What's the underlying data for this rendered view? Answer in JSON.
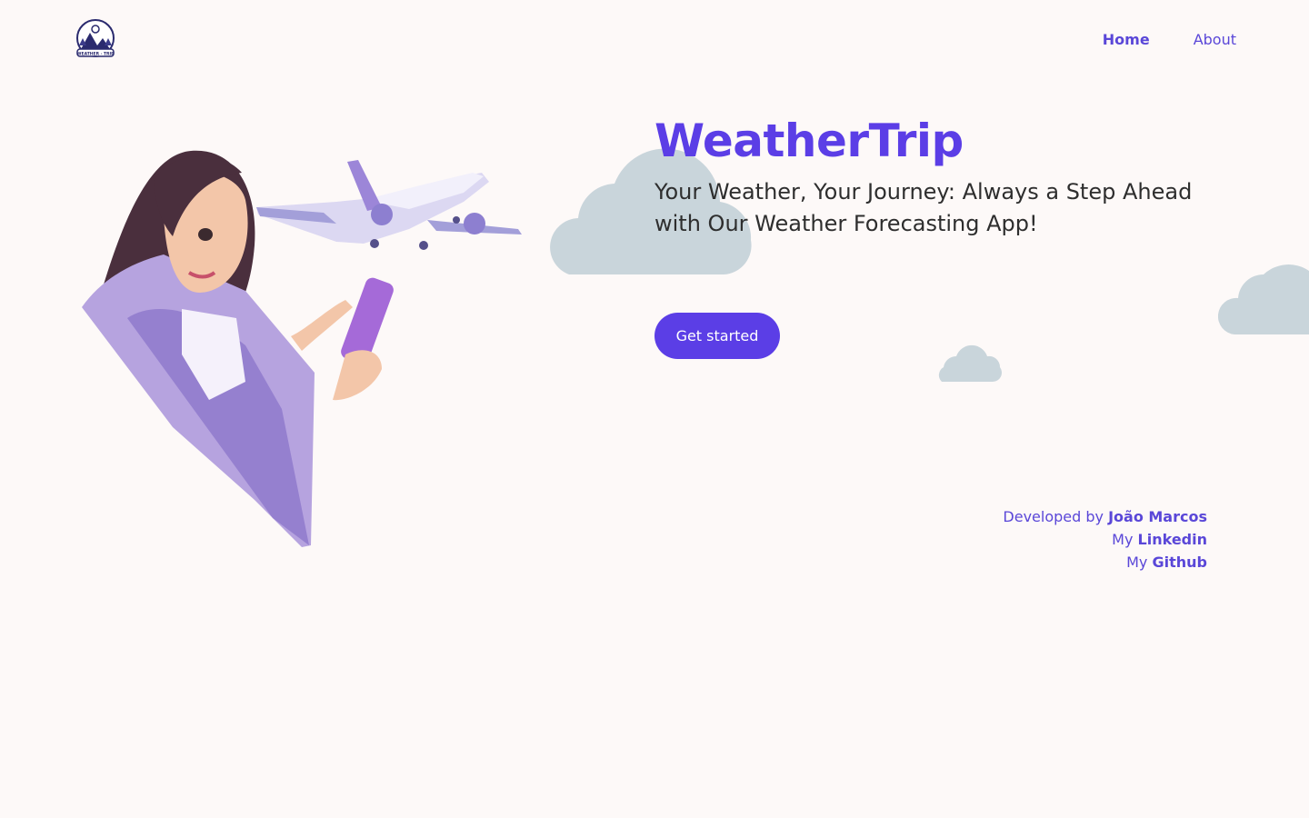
{
  "header": {
    "logo_text": "WEATHER · TRIP",
    "nav": [
      {
        "label": "Home",
        "active": true
      },
      {
        "label": "About",
        "active": false
      }
    ]
  },
  "hero": {
    "title": "WeatherTrip",
    "subtitle": "Your Weather, Your Journey: Always a Step Ahead with Our Weather Forecasting App!",
    "cta_label": "Get started"
  },
  "credits": {
    "developed_prefix": "Developed by",
    "developer_name": "João Marcos",
    "linkedin_prefix": "My",
    "linkedin_label": "Linkedin",
    "github_prefix": "My",
    "github_label": "Github"
  },
  "colors": {
    "background": "#fdf9f8",
    "accent": "#5b3ee6",
    "link": "#5a47d8",
    "cloud": "#c9d5db"
  }
}
